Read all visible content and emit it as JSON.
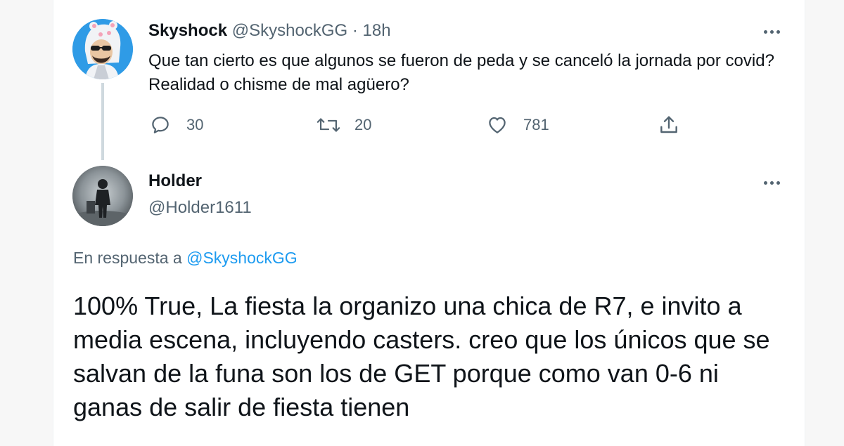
{
  "tweet1": {
    "display_name": "Skyshock",
    "handle": "@SkyshockGG",
    "separator": "·",
    "time": "18h",
    "text": "Que tan cierto es que algunos se fueron de peda y se canceló la jornada por covid? Realidad o chisme de mal agüero?",
    "replies": "30",
    "retweets": "20",
    "likes": "781"
  },
  "tweet2": {
    "display_name": "Holder",
    "handle": "@Holder1611",
    "reply_prefix": "En respuesta a",
    "reply_mention": "@SkyshockGG",
    "text": "100% True, La fiesta la organizo una chica de R7, e invito a media escena, incluyendo casters. creo que los únicos que se salvan de la funa son los de GET porque como van 0-6 ni ganas de salir de fiesta tienen"
  },
  "colors": {
    "text_primary": "#0f1419",
    "text_secondary": "#536471",
    "accent": "#1d9bf0",
    "thread_line": "#cfd9de"
  },
  "icons": {
    "reply": "reply-icon",
    "retweet": "retweet-icon",
    "like": "like-icon",
    "share": "share-icon",
    "more": "more-icon"
  }
}
